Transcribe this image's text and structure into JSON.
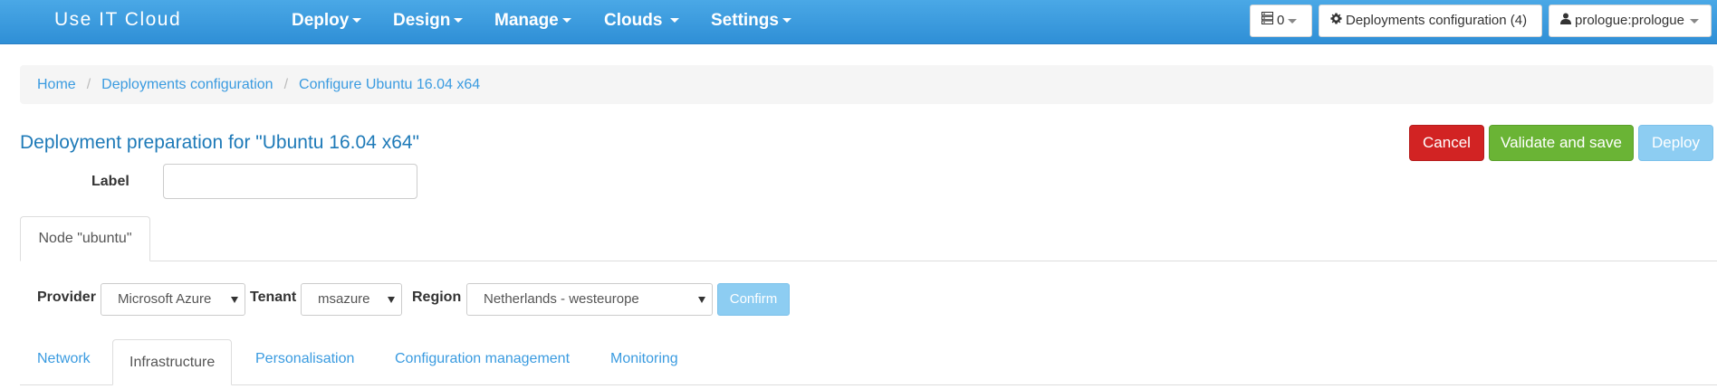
{
  "navbar": {
    "brand": "Use IT Cloud",
    "menu": [
      {
        "label": "Deploy"
      },
      {
        "label": "Design"
      },
      {
        "label": "Manage"
      },
      {
        "label": "Clouds"
      },
      {
        "label": "Settings"
      }
    ],
    "queue_count": "0",
    "deployments_config_label": "Deployments configuration (4)",
    "user_label": "prologue:prologue"
  },
  "breadcrumb": {
    "items": [
      "Home",
      "Deployments configuration",
      "Configure Ubuntu 16.04 x64"
    ],
    "separator": "/"
  },
  "page": {
    "title": "Deployment preparation for \"Ubuntu 16.04 x64\"",
    "actions": {
      "cancel": "Cancel",
      "validate": "Validate and save",
      "deploy": "Deploy"
    },
    "label_field": {
      "label": "Label",
      "value": ""
    }
  },
  "node_tab": {
    "label": "Node \"ubuntu\""
  },
  "provider_row": {
    "provider_label": "Provider",
    "provider_value": "Microsoft Azure",
    "tenant_label": "Tenant",
    "tenant_value": "msazure",
    "region_label": "Region",
    "region_value": "Netherlands - westeurope",
    "confirm": "Confirm"
  },
  "sub_tabs": [
    {
      "label": "Network",
      "active": false
    },
    {
      "label": "Infrastructure",
      "active": true
    },
    {
      "label": "Personalisation",
      "active": false
    },
    {
      "label": "Configuration management",
      "active": false
    },
    {
      "label": "Monitoring",
      "active": false
    }
  ],
  "colors": {
    "navbar": "#3a9be0",
    "link": "#3a9be0",
    "title": "#1e7ab8",
    "cancel": "#d22323",
    "validate": "#6ab435",
    "deploy_disabled": "#8dcdf2"
  },
  "icons": {
    "queue": "server-stack-icon",
    "config": "gear-icon",
    "user": "user-icon"
  }
}
